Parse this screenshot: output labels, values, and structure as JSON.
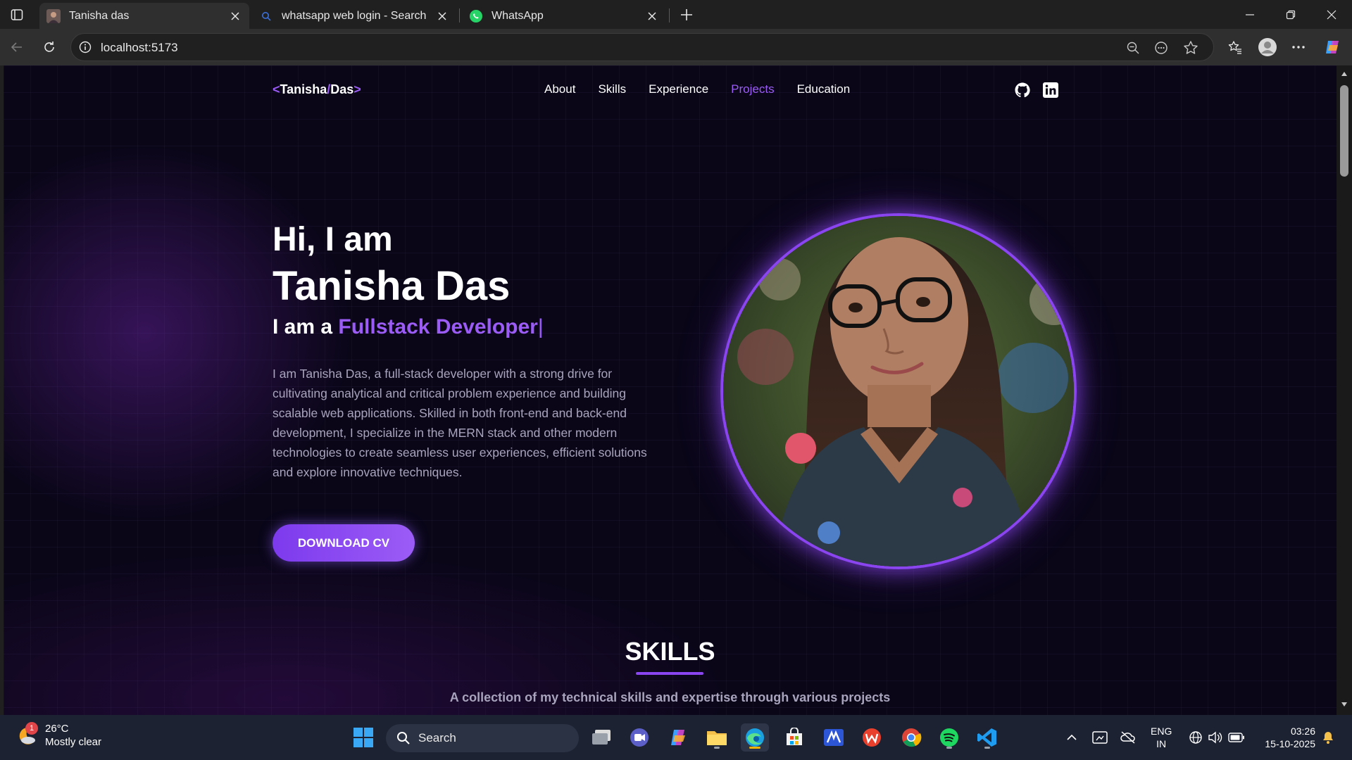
{
  "browser": {
    "tabs": [
      {
        "title": "Tanisha das",
        "active": true
      },
      {
        "title": "whatsapp web login - Search",
        "active": false
      },
      {
        "title": "WhatsApp",
        "active": false
      }
    ],
    "url": "localhost:5173"
  },
  "page": {
    "logo": {
      "lt": "<",
      "first": "Tanisha",
      "slash": "/",
      "last": "Das",
      "gt": ">"
    },
    "nav": [
      {
        "label": "About",
        "active": false
      },
      {
        "label": "Skills",
        "active": false
      },
      {
        "label": "Experience",
        "active": false
      },
      {
        "label": "Projects",
        "active": true
      },
      {
        "label": "Education",
        "active": false
      }
    ],
    "hero": {
      "greeting": "Hi, I am",
      "name": "Tanisha Das",
      "role_prefix": "I am a ",
      "role_highlight": "Fullstack Developer",
      "role_cursor": "|",
      "description": "I am Tanisha Das, a full-stack developer with a strong drive for cultivating analytical and critical problem experience and building scalable web applications. Skilled in both front-end and back-end development, I specialize in the MERN stack and other modern technologies to create seamless user experiences, efficient solutions and explore innovative techniques.",
      "cta": "DOWNLOAD CV"
    },
    "skills": {
      "title": "SKILLS",
      "subtitle": "A collection of my technical skills and expertise through various projects"
    },
    "accent_color": "#9b5cf6"
  },
  "taskbar": {
    "weather": {
      "temp": "26°C",
      "condition": "Mostly clear",
      "badge": "1"
    },
    "search_label": "Search",
    "language": {
      "line1": "ENG",
      "line2": "IN"
    },
    "time": "03:26",
    "date": "15-10-2025"
  }
}
